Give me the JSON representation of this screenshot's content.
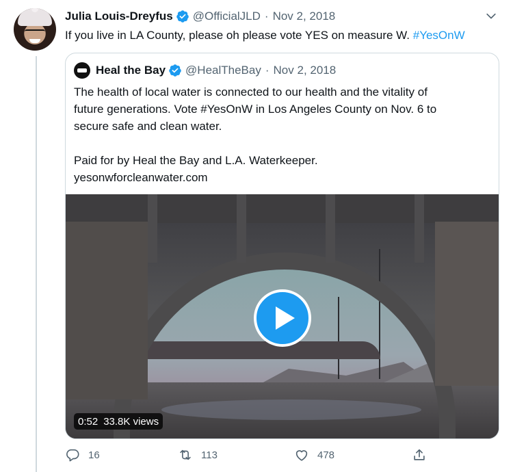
{
  "tweet": {
    "author_name": "Julia Louis-Dreyfus",
    "handle": "@OfficialJLD",
    "separator": "·",
    "date": "Nov 2, 2018",
    "text": "If you live in LA County, please oh please vote YES on measure W. ",
    "hashtag": "#YesOnW"
  },
  "quote": {
    "author_name": "Heal the Bay",
    "handle": "@HealTheBay",
    "separator": "·",
    "date": "Nov 2, 2018",
    "paragraph1": "The health of local water is connected to our health and the vitality of\nfuture generations. Vote #YesOnW in Los Angeles County on Nov. 6 to\nsecure safe and clean water.",
    "paragraph2": "Paid for by Heal the Bay and L.A. Waterkeeper.\nyesonwforcleanwater.com",
    "video": {
      "duration": "0:52",
      "views": "33.8K views"
    }
  },
  "actions": {
    "reply_count": "16",
    "retweet_count": "113",
    "like_count": "478"
  },
  "icons": [
    "verified-icon",
    "chevron-down-icon",
    "play-icon",
    "reply-icon",
    "retweet-icon",
    "like-icon",
    "share-icon"
  ],
  "colors": {
    "accent": "#1d9bf0",
    "text": "#0f1419",
    "muted": "#536471",
    "border": "#cfd9de"
  }
}
